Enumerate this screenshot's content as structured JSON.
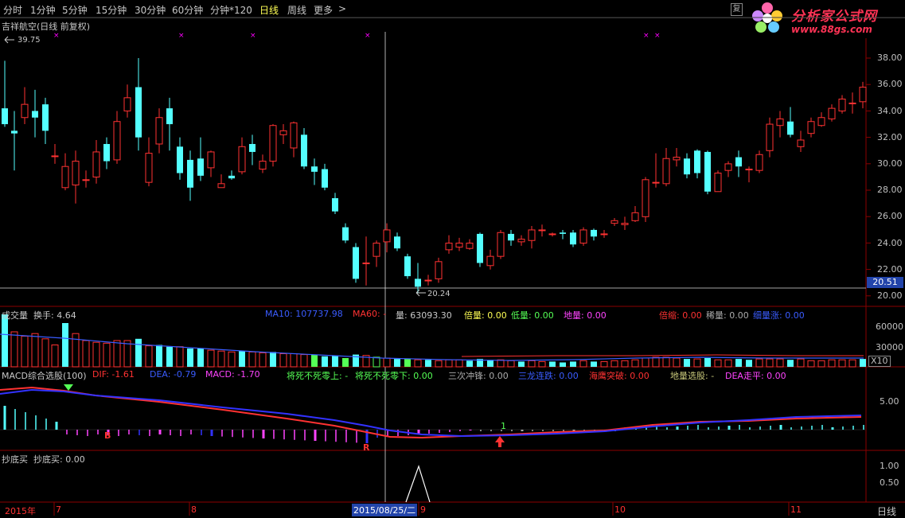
{
  "toolbar": {
    "items": [
      "分时",
      "1分钟",
      "5分钟",
      "15分钟",
      "30分钟",
      "60分钟",
      "分钟*120",
      "日线",
      "周线",
      "更多"
    ],
    "active_index": 7,
    "more_arrow": ">",
    "restore_button": "复"
  },
  "logo": {
    "title": "分析家公式网",
    "url": "www.88gs.com"
  },
  "price_panel": {
    "title": "吉祥航空(日线 前复权)",
    "high_label": "39.75",
    "low_label": "20.24",
    "current_price": "20.51",
    "axis_ticks": [
      "38.00",
      "36.00",
      "34.00",
      "32.00",
      "30.00",
      "28.00",
      "26.00",
      "24.00",
      "22.00",
      "20.00"
    ]
  },
  "volume_panel": {
    "name": "成交量",
    "turnover": "换手: 4.64",
    "ma10": "MA10: 107737.98",
    "ma60": "MA60: -",
    "volume": "量: 63093.30",
    "bei": "倍量: 0.00",
    "di": "低量: 0.00",
    "diliang": "地量: 0.00",
    "beisuo": "倍缩: 0.00",
    "xiliang": "稀量: 0.00",
    "xizhang": "细量涨: 0.00",
    "axis_ticks": [
      "60000",
      "30000"
    ],
    "unit": "X10"
  },
  "macd_panel": {
    "name": "MACD综合选股(100)",
    "dif": "DIF: -1.61",
    "dea": "DEA: -0.79",
    "macd": "MACD: -1.70",
    "s1": "将死不死零上: -",
    "s2": "将死不死零下: 0.00",
    "s3": "三次冲锋: 0.00",
    "s4": "三龙连跌: 0.00",
    "s5": "海鹰突破: 0.00",
    "s6": "地量选股: -",
    "s7": "DEA走平: 0.00",
    "axis_ticks": [
      "5.00"
    ],
    "marker_b": "B",
    "marker_r": "R",
    "marker_1": "1"
  },
  "bottom_panel": {
    "name": "抄底买",
    "value": "抄底买: 0.00",
    "axis_ticks": [
      "1.00",
      "0.50"
    ]
  },
  "date_axis": {
    "labels": [
      "2015年",
      "7",
      "8",
      "9",
      "10",
      "11"
    ],
    "cursor_date": "2015/08/25/二",
    "period": "日线"
  },
  "colors": {
    "up": "#ff3232",
    "down": "#54ffff",
    "ma": "#ff3232",
    "dea": "#3232ff",
    "magenta": "#ff00ff"
  }
}
